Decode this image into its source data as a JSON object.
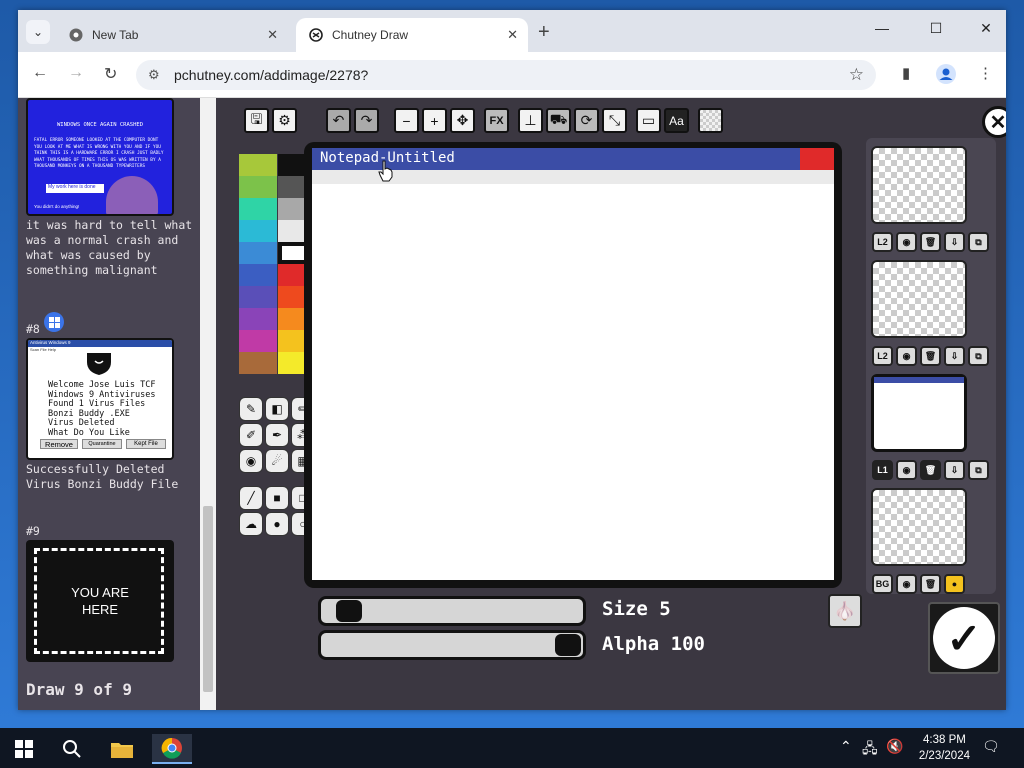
{
  "browser": {
    "tabs": [
      {
        "label": "New Tab",
        "favicon": "chrome-icon"
      },
      {
        "label": "Chutney Draw",
        "favicon": "chutney-icon"
      }
    ],
    "url": "pchutney.com/addimage/2278?"
  },
  "sidebar": {
    "thumb1": {
      "title": "WINDOWS ONCE AGAIN CRASHED",
      "body": "FATAL ERROR SOMEONE LOOKED AT THE COMPUTER DONT YOU LOOK AT ME WHAT IS WRONG WITH YOU AND IF YOU THINK THIS IS A HARDWARE ERROR I CRASH JUST BADLY WHAT THOUSANDS OF TIMES THIS OS WAS WRITTEN BY A THOUSAND MONKEYS ON A THOUSAND TYPEWRITERS",
      "button": "My work here is done",
      "footer": "You didn't do anything!"
    },
    "caption1": "it was hard to tell what was a normal crash and what was caused by something malignant",
    "num8": "#8",
    "thumb2": {
      "title": "Antivirus Windows 9",
      "menu": "Scan File Help",
      "lines": [
        "Welcome Jose Luis TCF",
        "Windows 9 Antiviruses",
        "Found 1 Virus Files",
        "Bonzi Buddy .EXE",
        "Virus Deleted",
        "What Do You Like"
      ],
      "buttons": [
        "Remove",
        "Quarantine",
        "Kept File"
      ]
    },
    "caption2": "Successfully Deleted Virus Bonzi Buddy File",
    "num9": "#9",
    "you_are_here": "YOU ARE HERE",
    "draw_counter": "Draw 9 of 9"
  },
  "draw": {
    "notepad_title": "Notepad-Untitled",
    "size_label": "Size 5",
    "alpha_label": "Alpha 100",
    "size_value": 5,
    "alpha_value": 100,
    "layer_labels": [
      "L2",
      "L2",
      "L1",
      "BG"
    ],
    "fx_label": "FX",
    "text_tool_label": "Aa"
  },
  "palette": {
    "left": [
      "#a7c83a",
      "#7cc24a",
      "#2fd4a6",
      "#2bbad6",
      "#3b8bd6",
      "#3b5ec2",
      "#5a4fb8",
      "#8a44b8",
      "#c03aa6",
      "#a86a3a"
    ],
    "right": [
      "#111111",
      "#555555",
      "#a8a8a8",
      "#e8e8e8",
      "#ffffff",
      "#e02a2a",
      "#ee4a1e",
      "#f58a1e",
      "#f4c21e",
      "#f4ea2a"
    ]
  },
  "taskbar": {
    "time": "4:38 PM",
    "date": "2/23/2024"
  }
}
